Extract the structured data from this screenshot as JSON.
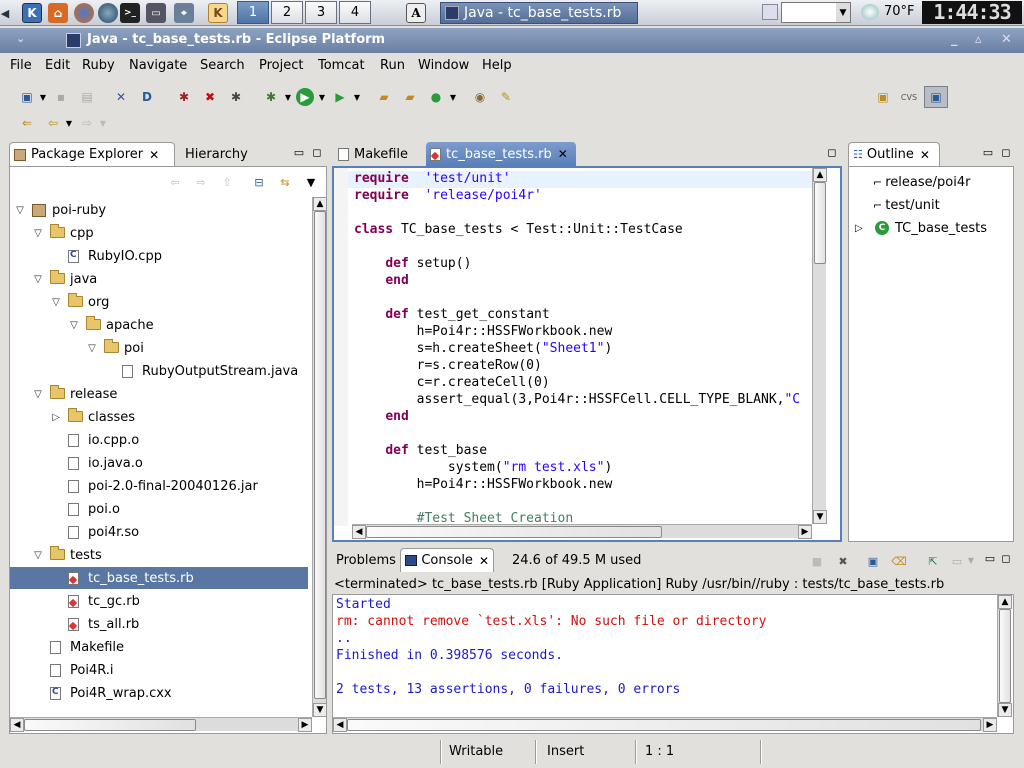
{
  "taskbar": {
    "workspaces": [
      "1",
      "2",
      "3",
      "4"
    ],
    "active_window": "Java - tc_base_tests.rb",
    "weather": "70°F",
    "clock": "1:44:33"
  },
  "window": {
    "title": "Java - tc_base_tests.rb - Eclipse Platform"
  },
  "menu": [
    "File",
    "Edit",
    "Ruby",
    "Navigate",
    "Search",
    "Project",
    "Tomcat",
    "Run",
    "Window",
    "Help"
  ],
  "package_explorer": {
    "tab_label": "Package Explorer",
    "tab2_label": "Hierarchy",
    "tree": [
      {
        "label": "poi-ruby",
        "level": 0,
        "kind": "pkg",
        "twist": "open"
      },
      {
        "label": "cpp",
        "level": 1,
        "kind": "folder",
        "twist": "open"
      },
      {
        "label": "RubyIO.cpp",
        "level": 2,
        "kind": "c",
        "twist": ""
      },
      {
        "label": "java",
        "level": 1,
        "kind": "folder",
        "twist": "open"
      },
      {
        "label": "org",
        "level": 2,
        "kind": "folder",
        "twist": "open"
      },
      {
        "label": "apache",
        "level": 3,
        "kind": "folder",
        "twist": "open"
      },
      {
        "label": "poi",
        "level": 4,
        "kind": "folder",
        "twist": "open"
      },
      {
        "label": "RubyOutputStream.java",
        "level": 5,
        "kind": "file",
        "twist": ""
      },
      {
        "label": "release",
        "level": 1,
        "kind": "folder",
        "twist": "open"
      },
      {
        "label": "classes",
        "level": 2,
        "kind": "folder",
        "twist": "closed"
      },
      {
        "label": "io.cpp.o",
        "level": 2,
        "kind": "file",
        "twist": ""
      },
      {
        "label": "io.java.o",
        "level": 2,
        "kind": "file",
        "twist": ""
      },
      {
        "label": "poi-2.0-final-20040126.jar",
        "level": 2,
        "kind": "file",
        "twist": ""
      },
      {
        "label": "poi.o",
        "level": 2,
        "kind": "file",
        "twist": ""
      },
      {
        "label": "poi4r.so",
        "level": 2,
        "kind": "file",
        "twist": ""
      },
      {
        "label": "tests",
        "level": 1,
        "kind": "folder",
        "twist": "open"
      },
      {
        "label": "tc_base_tests.rb",
        "level": 2,
        "kind": "rb",
        "twist": "",
        "selected": true
      },
      {
        "label": "tc_gc.rb",
        "level": 2,
        "kind": "rb",
        "twist": ""
      },
      {
        "label": "ts_all.rb",
        "level": 2,
        "kind": "rb",
        "twist": ""
      },
      {
        "label": "Makefile",
        "level": 1,
        "kind": "file",
        "twist": ""
      },
      {
        "label": "Poi4R.i",
        "level": 1,
        "kind": "file",
        "twist": ""
      },
      {
        "label": "Poi4R_wrap.cxx",
        "level": 1,
        "kind": "c",
        "twist": ""
      }
    ]
  },
  "editor": {
    "tabs": [
      "Makefile",
      "tc_base_tests.rb"
    ],
    "lines": [
      [
        [
          "kw",
          "require"
        ],
        [
          "",
          "  "
        ],
        [
          "str",
          "'test/unit'"
        ]
      ],
      [
        [
          "kw",
          "require"
        ],
        [
          "",
          "  "
        ],
        [
          "str",
          "'release/poi4r'"
        ]
      ],
      [],
      [
        [
          "kw",
          "class"
        ],
        [
          "",
          " TC_base_tests < Test::Unit::TestCase"
        ]
      ],
      [],
      [
        [
          "",
          "    "
        ],
        [
          "kw",
          "def"
        ],
        [
          "",
          " setup()"
        ]
      ],
      [
        [
          "",
          "    "
        ],
        [
          "kw",
          "end"
        ]
      ],
      [],
      [
        [
          "",
          "    "
        ],
        [
          "kw",
          "def"
        ],
        [
          "",
          " test_get_constant"
        ]
      ],
      [
        [
          "",
          "        h=Poi4r::HSSFWorkbook.new"
        ]
      ],
      [
        [
          "",
          "        s=h.createSheet("
        ],
        [
          "str",
          "\"Sheet1\""
        ],
        [
          "",
          ")"
        ]
      ],
      [
        [
          "",
          "        r=s.createRow(0)"
        ]
      ],
      [
        [
          "",
          "        c=r.createCell(0)"
        ]
      ],
      [
        [
          "",
          "        assert_equal(3,Poi4r::HSSFCell.CELL_TYPE_BLANK,"
        ],
        [
          "str",
          "\"C"
        ]
      ],
      [
        [
          "",
          "    "
        ],
        [
          "kw",
          "end"
        ]
      ],
      [],
      [
        [
          "",
          "    "
        ],
        [
          "kw",
          "def"
        ],
        [
          "",
          " test_base"
        ]
      ],
      [
        [
          "",
          "            system("
        ],
        [
          "str",
          "\"rm test.xls\""
        ],
        [
          "",
          ")"
        ]
      ],
      [
        [
          "",
          "        h=Poi4r::HSSFWorkbook.new"
        ]
      ],
      [],
      [
        [
          "cm",
          "        #Test Sheet Creation"
        ]
      ]
    ]
  },
  "outline": {
    "tab_label": "Outline",
    "items": [
      "release/poi4r",
      "test/unit",
      "TC_base_tests"
    ]
  },
  "console": {
    "tab1": "Problems",
    "tab2": "Console",
    "memory": "24.6 of 49.5 M used",
    "header": "<terminated> tc_base_tests.rb [Ruby Application] Ruby /usr/bin//ruby : tests/tc_base_tests.rb",
    "lines": [
      {
        "text": "Started",
        "color": "#1a1ac8"
      },
      {
        "text": "rm: cannot remove `test.xls': No such file or directory",
        "color": "#d01010"
      },
      {
        "text": "..",
        "color": "#1a1ac8"
      },
      {
        "text": "Finished in 0.398576 seconds.",
        "color": "#1a1ac8"
      },
      {
        "text": "",
        "color": "#1a1ac8"
      },
      {
        "text": "2 tests, 13 assertions, 0 failures, 0 errors",
        "color": "#1a1ac8"
      }
    ]
  },
  "status": {
    "writable": "Writable",
    "insert": "Insert",
    "position": "1 : 1"
  }
}
